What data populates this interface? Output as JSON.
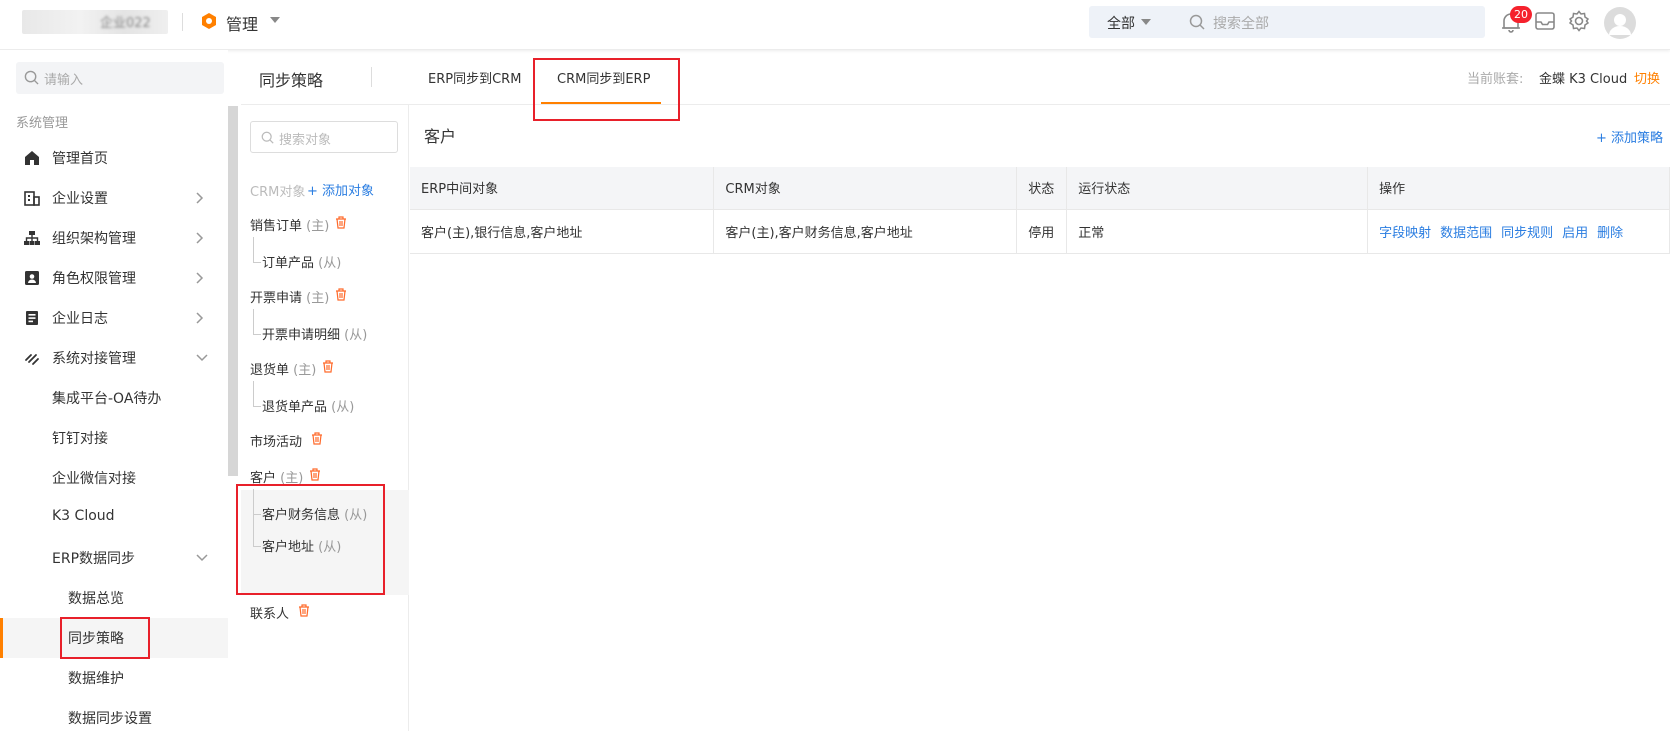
{
  "topbar": {
    "company_blur": "企业022",
    "app_name": "管理",
    "search_scope": "全部",
    "search_placeholder": "搜索全部",
    "notification_count": "20"
  },
  "sidebar": {
    "search_placeholder": "请输入",
    "section_title": "系统管理",
    "items": [
      {
        "label": "管理首页"
      },
      {
        "label": "企业设置"
      },
      {
        "label": "组织架构管理"
      },
      {
        "label": "角色权限管理"
      },
      {
        "label": "企业日志"
      },
      {
        "label": "系统对接管理"
      },
      {
        "label": "集成平台-OA待办"
      },
      {
        "label": "钉钉对接"
      },
      {
        "label": "企业微信对接"
      },
      {
        "label": "K3 Cloud"
      },
      {
        "label": "ERP数据同步"
      },
      {
        "label": "数据总览"
      },
      {
        "label": "同步策略"
      },
      {
        "label": "数据维护"
      },
      {
        "label": "数据同步设置"
      }
    ]
  },
  "header": {
    "title": "同步策略",
    "tabs": [
      {
        "label": "ERP同步到CRM"
      },
      {
        "label": "CRM同步到ERP"
      }
    ],
    "account_label": "当前账套:",
    "account_value": "金蝶 K3 Cloud",
    "switch_label": "切换"
  },
  "objects": {
    "search_placeholder": "搜索对象",
    "header_label": "CRM对象",
    "add_label": "添加对象",
    "master_tag": "(主)",
    "slave_tag": "(从)",
    "groups": [
      {
        "name": "销售订单",
        "children": [
          "订单产品"
        ]
      },
      {
        "name": "开票申请",
        "children": [
          "开票申请明细"
        ]
      },
      {
        "name": "退货单",
        "children": [
          "退货单产品"
        ]
      },
      {
        "name": "市场活动",
        "children": []
      },
      {
        "name": "客户",
        "children": [
          "客户财务信息",
          "客户地址"
        ]
      },
      {
        "name": "联系人",
        "children": []
      }
    ]
  },
  "content": {
    "title": "客户",
    "add_strategy": "添加策略",
    "columns": [
      "ERP中间对象",
      "CRM对象",
      "状态",
      "运行状态",
      "操作"
    ],
    "rows": [
      {
        "erp": "客户(主),银行信息,客户地址",
        "crm": "客户(主),客户财务信息,客户地址",
        "status": "停用",
        "run_status": "正常",
        "actions": [
          "字段映射",
          "数据范围",
          "同步规则",
          "启用",
          "删除"
        ]
      }
    ]
  },
  "colors": {
    "accent": "#ff8000",
    "link": "#2a7de1",
    "annotation": "#e8202a"
  }
}
